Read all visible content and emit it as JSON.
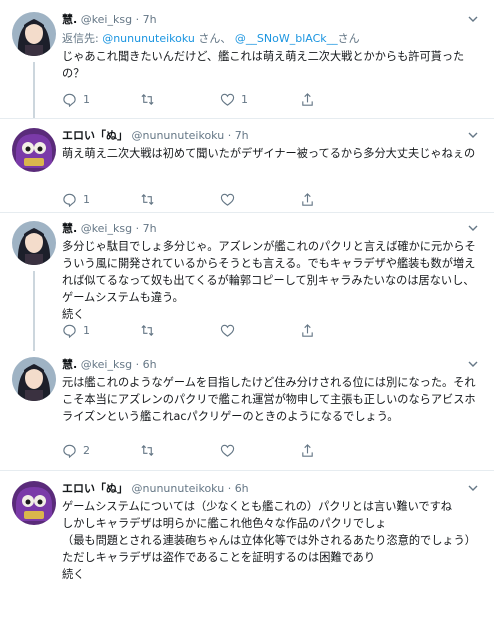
{
  "tweets": [
    {
      "display_name": "慧.",
      "handle": "@kei_ksg",
      "sep": "·",
      "time": "7h",
      "reply_prefix": "返信先: ",
      "reply_user1": "@nununuteikoku",
      "reply_mid": " さん、 ",
      "reply_user2": "@__SNoW_blACk__",
      "reply_suffix": "さん",
      "text": "じゃあこれ聞きたいんだけど、艦これは萌え萌え二次大戦とかからも許可貰ったの？",
      "reply_count": "1",
      "retweet_count": "",
      "like_count": "1",
      "avatar": "girl-avatar"
    },
    {
      "display_name": "エロい「ぬ」",
      "handle": "@nununuteikoku",
      "sep": "·",
      "time": "7h",
      "text": "萌え萌え二次大戦は初めて聞いたがデザイナー被ってるから多分大丈夫じゃねぇの",
      "reply_count": "1",
      "retweet_count": "",
      "like_count": "",
      "avatar": "purple-creature-avatar"
    },
    {
      "display_name": "慧.",
      "handle": "@kei_ksg",
      "sep": "·",
      "time": "7h",
      "text": "多分じゃ駄目でしょ多分じゃ。アズレンが艦これのパクリと言えば確かに元からそういう風に開発されているからそうとも言える。でもキャラデザや艦装も数が増えれば似てるなって奴も出てくるが輪郭コピーして別キャラみたいなのは居ないし、ゲームシステムも違う。\n続く",
      "reply_count": "1",
      "retweet_count": "",
      "like_count": "",
      "avatar": "girl-avatar"
    },
    {
      "display_name": "慧.",
      "handle": "@kei_ksg",
      "sep": "·",
      "time": "6h",
      "text": "元は艦これのようなゲームを目指したけど住み分けされる位には別になった。それこそ本当にアズレンのパクリで艦これ運営が物申して主張も正しいのならアビスホライズンという艦これacパクリゲーのときのようになるでしょう。",
      "reply_count": "2",
      "retweet_count": "",
      "like_count": "",
      "avatar": "girl-avatar"
    },
    {
      "display_name": "エロい「ぬ」",
      "handle": "@nununuteikoku",
      "sep": "·",
      "time": "6h",
      "text": "ゲームシステムについては（少なくとも艦これの）パクリとは言い難いですね\nしかしキャラデザは明らかに艦これ他色々な作品のパクリでしょ\n（最も問題とされる連装砲ちゃんは立体化等では外されるあたり恣意的でしょう）\nただしキャラデザは盗作であることを証明するのは困難であり\n続く",
      "avatar": "purple-creature-avatar"
    }
  ]
}
